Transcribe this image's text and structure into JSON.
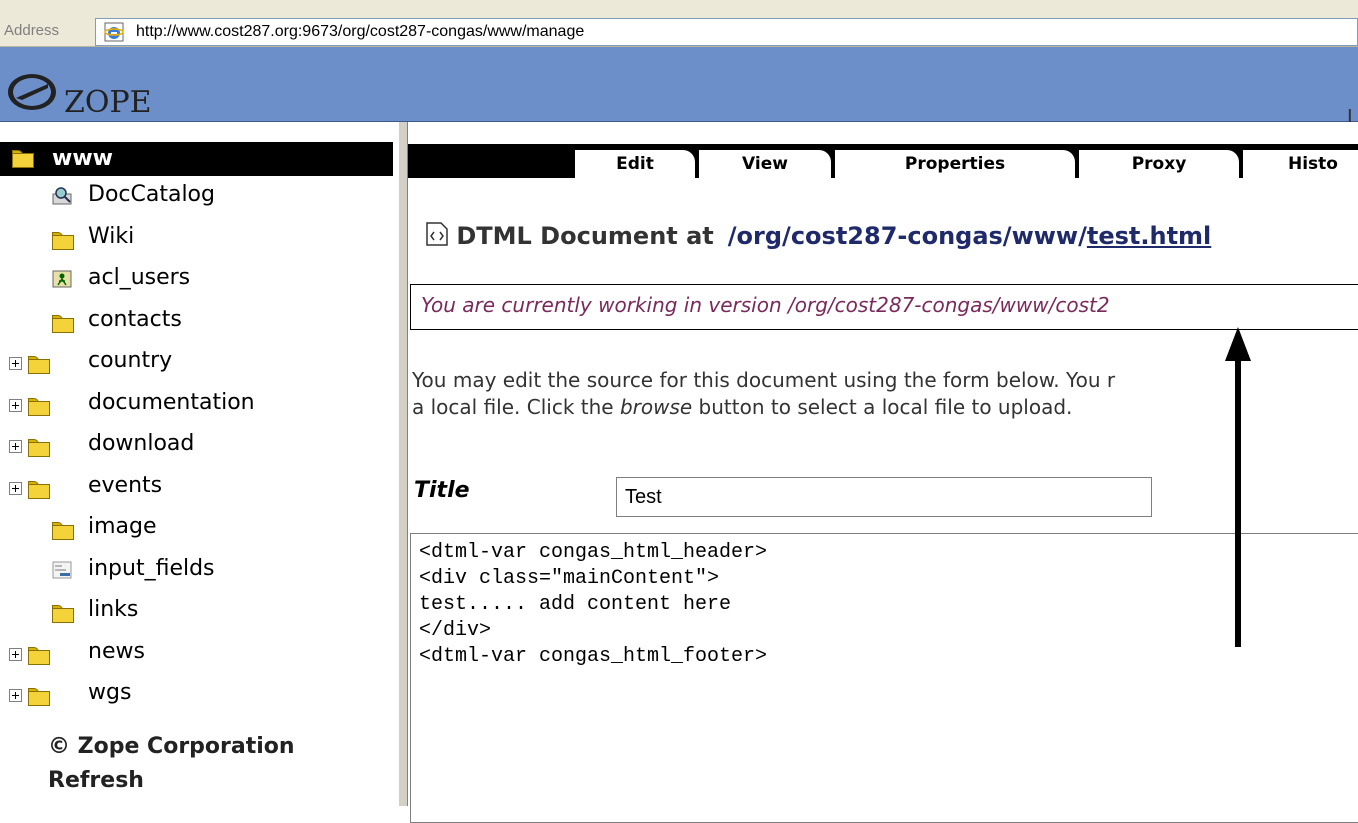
{
  "browser": {
    "address_label": "Address",
    "url": "http://www.cost287.org:9673/org/cost287-congas/www/manage"
  },
  "header": {
    "logo_text": "ZOPE",
    "right_text": "L"
  },
  "tree": {
    "root": "www",
    "items": [
      {
        "label": "DocCatalog",
        "icon": "catalog-icon",
        "expandable": false
      },
      {
        "label": "Wiki",
        "icon": "folder-icon",
        "expandable": false
      },
      {
        "label": "acl_users",
        "icon": "user-folder-icon",
        "expandable": false
      },
      {
        "label": "contacts",
        "icon": "folder-icon",
        "expandable": false
      },
      {
        "label": "country",
        "icon": "folder-icon",
        "expandable": true
      },
      {
        "label": "documentation",
        "icon": "folder-icon",
        "expandable": true
      },
      {
        "label": "download",
        "icon": "folder-icon",
        "expandable": true
      },
      {
        "label": "events",
        "icon": "folder-icon",
        "expandable": true
      },
      {
        "label": "image",
        "icon": "folder-icon",
        "expandable": false
      },
      {
        "label": "input_fields",
        "icon": "form-icon",
        "expandable": false
      },
      {
        "label": "links",
        "icon": "folder-icon",
        "expandable": false
      },
      {
        "label": "news",
        "icon": "folder-icon",
        "expandable": true
      },
      {
        "label": "wgs",
        "icon": "folder-icon",
        "expandable": true
      }
    ],
    "copyright": "© Zope Corporation",
    "refresh": "Refresh"
  },
  "tabs": [
    "Edit",
    "View",
    "Properties",
    "Proxy",
    "Histo"
  ],
  "document": {
    "heading_prefix": "DTML Document at",
    "path_prefix": "/org/cost287-congas/www/",
    "path_link": "test.html",
    "version_notice": "You are currently working in version /org/cost287-congas/www/cost2",
    "description_line1_a": "You may edit the source for this document using the form below. You r",
    "description_line2_a": "a local file. Click the ",
    "description_line2_em": "browse",
    "description_line2_b": " button to select a local file to upload.",
    "title_label": "Title",
    "title_value": "Test",
    "source": "<dtml-var congas_html_header>\n<div class=\"mainContent\">\ntest..... add content here\n</div>\n<dtml-var congas_html_footer>"
  },
  "colors": {
    "header_bg": "#6d8fc9",
    "version_text": "#7a2a5a",
    "path_text": "#1f2a6b"
  }
}
